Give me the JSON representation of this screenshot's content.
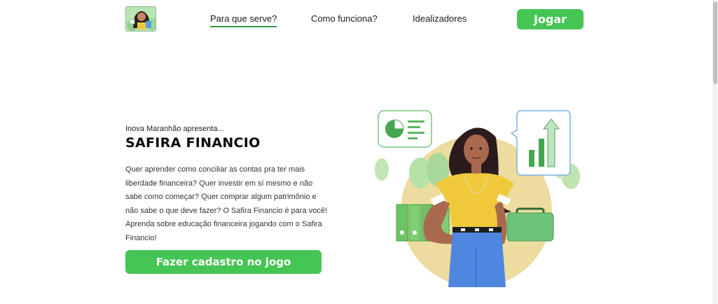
{
  "header": {
    "logo_icon": "safira-character-logo",
    "nav": [
      {
        "label": "Para que serve?",
        "active": true
      },
      {
        "label": "Como funciona?",
        "active": false
      },
      {
        "label": "Idealizadores",
        "active": false
      }
    ],
    "play_label": "Jogar"
  },
  "hero": {
    "presenter": "Inova Maranhão apresenta...",
    "title": "SAFIRA FINANCIO",
    "description": "Quer aprender como conciliar as contas pra ter mais liberdade financeira? Quer investir em sí mesmo e não sabe como começar? Quer comprar algum patrimônio e não sabe o que deve fazer? O Safira Financio é para você! Aprenda sobre educação financeira jogando com o Safira Financio!",
    "cta_label": "Fazer cadastro no jogo",
    "illustration_icon": "woman-finance-illustration"
  },
  "colors": {
    "brand_green": "#45c553",
    "nav_underline": "#2e9b4a",
    "circle_bg": "#eddca0"
  }
}
